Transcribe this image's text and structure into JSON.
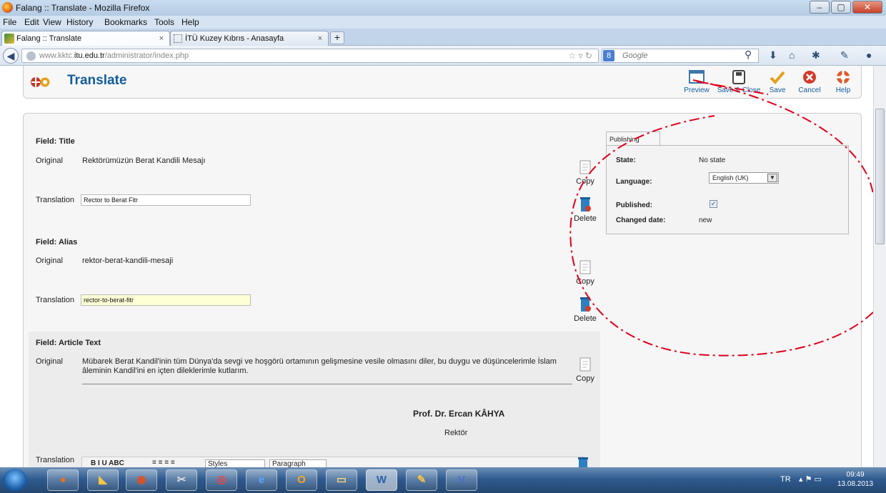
{
  "window": {
    "title": "Falang :: Translate - Mozilla Firefox",
    "min": "–",
    "max": "▢",
    "close": "✕"
  },
  "menu": [
    "File",
    "Edit",
    "View",
    "History",
    "Bookmarks",
    "Tools",
    "Help"
  ],
  "tabs": [
    {
      "label": "Falang :: Translate",
      "close": "×"
    },
    {
      "label": "İTÜ Kuzey Kıbrıs - Anasayfa",
      "close": "×"
    }
  ],
  "new_tab": "+",
  "address": {
    "prefix": "www.kktc.",
    "domain": "itu.edu.tr",
    "path": "/administrator/index.php"
  },
  "search": {
    "placeholder": "Google"
  },
  "page": {
    "title": "Translate",
    "toolbar": {
      "preview": "Preview",
      "save_close": "Save & Close",
      "save": "Save",
      "cancel": "Cancel",
      "help": "Help"
    },
    "fields": {
      "title_label": "Field: Title",
      "original_label": "Original",
      "translation_label": "Translation",
      "title_original": "Rektörümüzün Berat Kandili Mesajı",
      "title_translation": "Rector to Berat Fitr",
      "alias_label": "Field: Alias",
      "alias_original": "rektor-berat-kandili-mesaji",
      "alias_translation": "rector-to-berat-fitr",
      "article_label": "Field: Article Text",
      "article_original": "Mübarek Berat Kandil'inin tüm Dünya'da sevgi ve hoşgörü ortamının gelişmesine vesile olmasını diler,  bu duygu ve düşüncelerimle İslam âleminin Kandil'ini en içten dileklerimle kutlarım.",
      "signature": "Prof. Dr. Ercan KÂHYA",
      "signature_role": "Rektör",
      "copy": "Copy",
      "delete": "Delete",
      "editor_styles": "Styles",
      "editor_paragraph": "Paragraph"
    },
    "publishing": {
      "tab": "Publishing",
      "state_label": "State:",
      "state_value": "No state",
      "language_label": "Language:",
      "language_value": "English (UK)",
      "published_label": "Published:",
      "published": true,
      "changed_label": "Changed date:",
      "changed_value": "new"
    }
  },
  "taskbar": {
    "lang": "TR",
    "time": "09:49",
    "date": "13.08.2013"
  },
  "colors": {
    "accent": "#135c9c",
    "annotation": "#e0001a"
  }
}
